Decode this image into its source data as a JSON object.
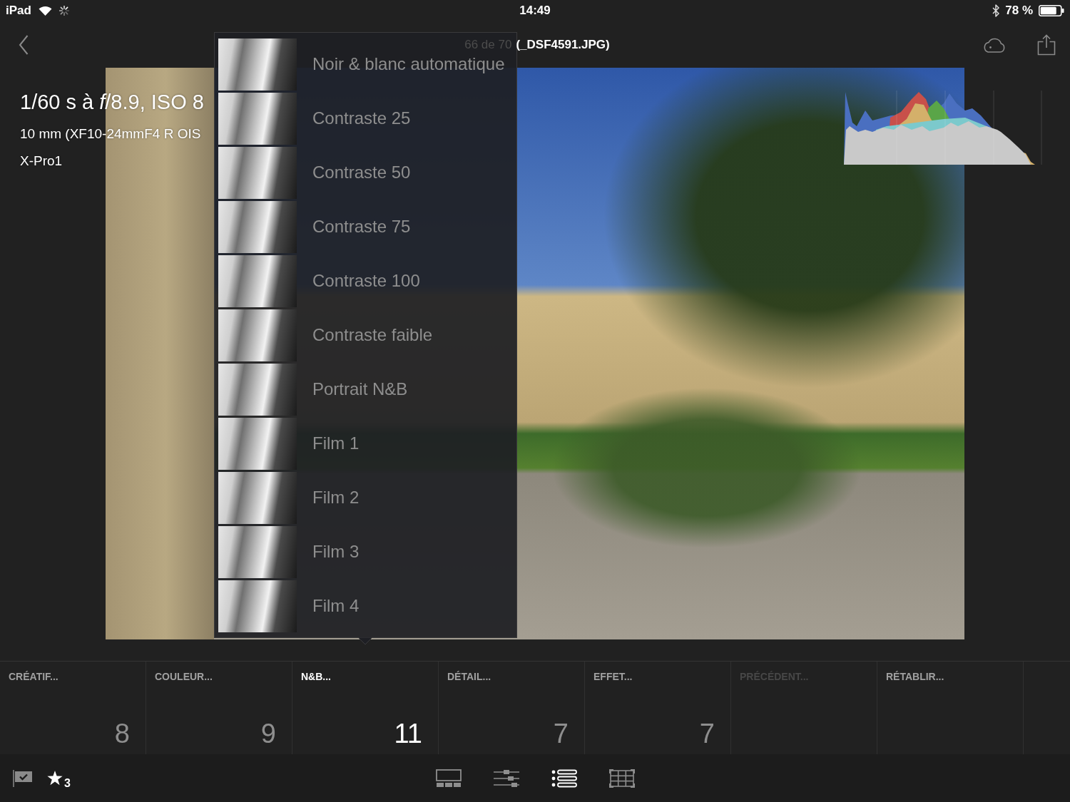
{
  "status_bar": {
    "device": "iPad",
    "time": "14:49",
    "battery": "78 %"
  },
  "nav_bar": {
    "counter": "66 de 70",
    "filename": "(_DSF4591.JPG)"
  },
  "photo_info": {
    "exposure": "1/60 s à *f*/8.9, ISO 8",
    "lens": "10 mm (XF10-24mmF4 R OIS",
    "camera": "X-Pro1"
  },
  "preset_menu": {
    "items": [
      {
        "label": "Noir & blanc automatique"
      },
      {
        "label": "Contraste 25"
      },
      {
        "label": "Contraste 50"
      },
      {
        "label": "Contraste 75"
      },
      {
        "label": "Contraste 100"
      },
      {
        "label": "Contraste faible"
      },
      {
        "label": "Portrait N&B"
      },
      {
        "label": "Film 1"
      },
      {
        "label": "Film 2"
      },
      {
        "label": "Film 3"
      },
      {
        "label": "Film 4"
      }
    ]
  },
  "tabs": [
    {
      "label": "CRÉATIF...",
      "count": "8",
      "selected": false,
      "disabled": false
    },
    {
      "label": "COULEUR...",
      "count": "9",
      "selected": false,
      "disabled": false
    },
    {
      "label": "N&B...",
      "count": "11",
      "selected": true,
      "disabled": false
    },
    {
      "label": "DÉTAIL...",
      "count": "7",
      "selected": false,
      "disabled": false
    },
    {
      "label": "EFFET...",
      "count": "7",
      "selected": false,
      "disabled": false
    },
    {
      "label": "PRÉCÉDENT...",
      "selected": false,
      "disabled": true
    },
    {
      "label": "RÉTABLIR...",
      "selected": false,
      "disabled": false
    }
  ],
  "toolbar": {
    "flagged": true,
    "rating": "3",
    "views": [
      {
        "kind": "filmstrip",
        "selected": false
      },
      {
        "kind": "adjust",
        "selected": false
      },
      {
        "kind": "presets",
        "selected": true
      },
      {
        "kind": "crop",
        "selected": false
      }
    ]
  }
}
